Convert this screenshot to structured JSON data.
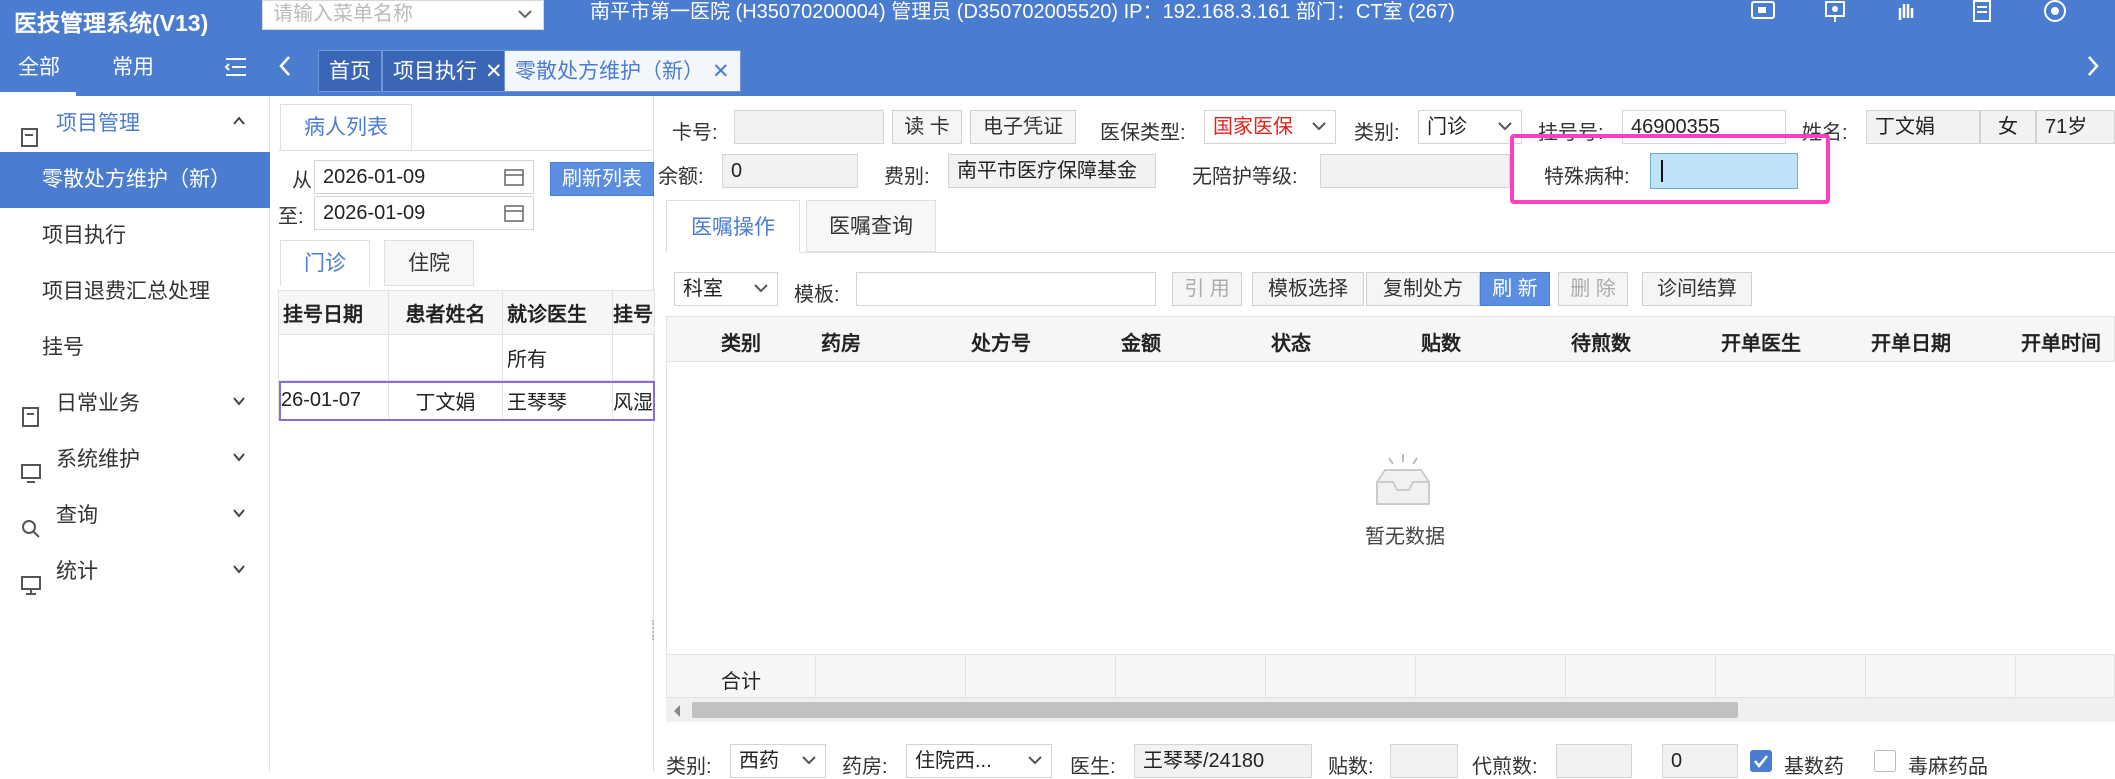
{
  "app": {
    "title": "医技管理系统(V13)",
    "menu_search_placeholder": "请输入菜单名称",
    "session_info": "南平市第一医院 (H35070200004) 管理员 (D350702005520) IP：192.168.3.161 部门：CT室 (267)"
  },
  "nav": {
    "all_tab": "全部",
    "common_tab": "常用",
    "page_tabs": [
      {
        "label": "首页"
      },
      {
        "label": "项目执行"
      },
      {
        "label": "零散处方维护（新）"
      }
    ]
  },
  "sidebar": {
    "items": [
      {
        "label": "项目管理"
      },
      {
        "label": "零散处方维护（新）"
      },
      {
        "label": "项目执行"
      },
      {
        "label": "项目退费汇总处理"
      },
      {
        "label": "挂号"
      },
      {
        "label": "日常业务"
      },
      {
        "label": "系统维护"
      },
      {
        "label": "查询"
      },
      {
        "label": "统计"
      }
    ]
  },
  "patient_list": {
    "tab_label": "病人列表",
    "from_label": "从",
    "to_label": "至:",
    "date_from": "2026-01-09",
    "date_to": "2026-01-09",
    "refresh_button": "刷新列表",
    "tabs": [
      {
        "label": "门诊"
      },
      {
        "label": "住院"
      }
    ],
    "columns": [
      "挂号日期",
      "患者姓名",
      "就诊医生",
      "挂号"
    ],
    "filter_row": [
      "",
      "",
      "所有",
      ""
    ],
    "rows": [
      [
        "26-01-07",
        "丁文娟",
        "王琴琴",
        "风湿"
      ]
    ]
  },
  "header_form": {
    "card_label": "卡号:",
    "card_value": "",
    "read_card_button": "读 卡",
    "e_voucher_button": "电子凭证",
    "insurance_type_label": "医保类型:",
    "insurance_type_value": "国家医保",
    "category_label": "类别:",
    "category_value": "门诊",
    "reg_no_label": "挂号号:",
    "reg_no_value": "46900355",
    "name_label": "姓名:",
    "name_value": "丁文娟",
    "gender_value": "女",
    "age_value": "71岁",
    "balance_label": "余额:",
    "balance_value": "0",
    "fee_type_label": "费别:",
    "fee_type_value": "南平市医疗保障基金",
    "escort_level_label": "无陪护等级:",
    "escort_level_value": "",
    "special_disease_label": "特殊病种:",
    "special_disease_value": ""
  },
  "orders": {
    "tabs": [
      {
        "label": "医嘱操作"
      },
      {
        "label": "医嘱查询"
      }
    ],
    "dept_select": "科室",
    "template_label": "模板:",
    "template_value": "",
    "buttons": [
      "引 用",
      "模板选择",
      "复制处方",
      "刷 新",
      "删 除",
      "诊间结算"
    ],
    "columns": [
      "类别",
      "药房",
      "处方号",
      "金额",
      "状态",
      "贴数",
      "待煎数",
      "开单医生",
      "开单日期",
      "开单时间"
    ],
    "empty_text": "暂无数据",
    "total_label": "合计"
  },
  "bottom_form": {
    "category_label": "类别:",
    "category_value": "西药",
    "pharmacy_label": "药房:",
    "pharmacy_value": "住院西...",
    "doctor_label": "医生:",
    "doctor_value": "王琴琴/24180",
    "packs_label": "贴数:",
    "packs_value": "",
    "decoct_label": "代煎数:",
    "decoct_value": "",
    "count_value": "0",
    "essential_drug_label": "基数药",
    "essential_drug_checked": true,
    "narcotic_label": "毒麻药品",
    "narcotic_checked": false
  },
  "colors": {
    "primary": "#4a7cd0",
    "highlight": "#ff3fbf",
    "insurance_red": "#e0231c",
    "focus_field": "#bfe2f6"
  }
}
